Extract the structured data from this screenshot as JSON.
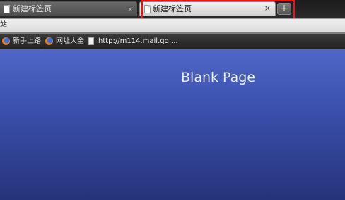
{
  "tabs": [
    {
      "label": "新建标签页",
      "close": "×"
    },
    {
      "label": "新建标签页",
      "close": "×"
    }
  ],
  "new_tab_label": "+",
  "address": {
    "fragment": "站"
  },
  "bookmarks": [
    {
      "label": "新手上路",
      "icon": "firefox-icon"
    },
    {
      "label": "网址大全",
      "icon": "firefox-icon"
    },
    {
      "label": "http://m114.mail.qq....",
      "icon": "page-icon"
    }
  ],
  "content": {
    "title": "Blank Page"
  },
  "colors": {
    "highlight": "#e8141a",
    "content_top": "#4f67c7",
    "content_bottom": "#25337a"
  }
}
